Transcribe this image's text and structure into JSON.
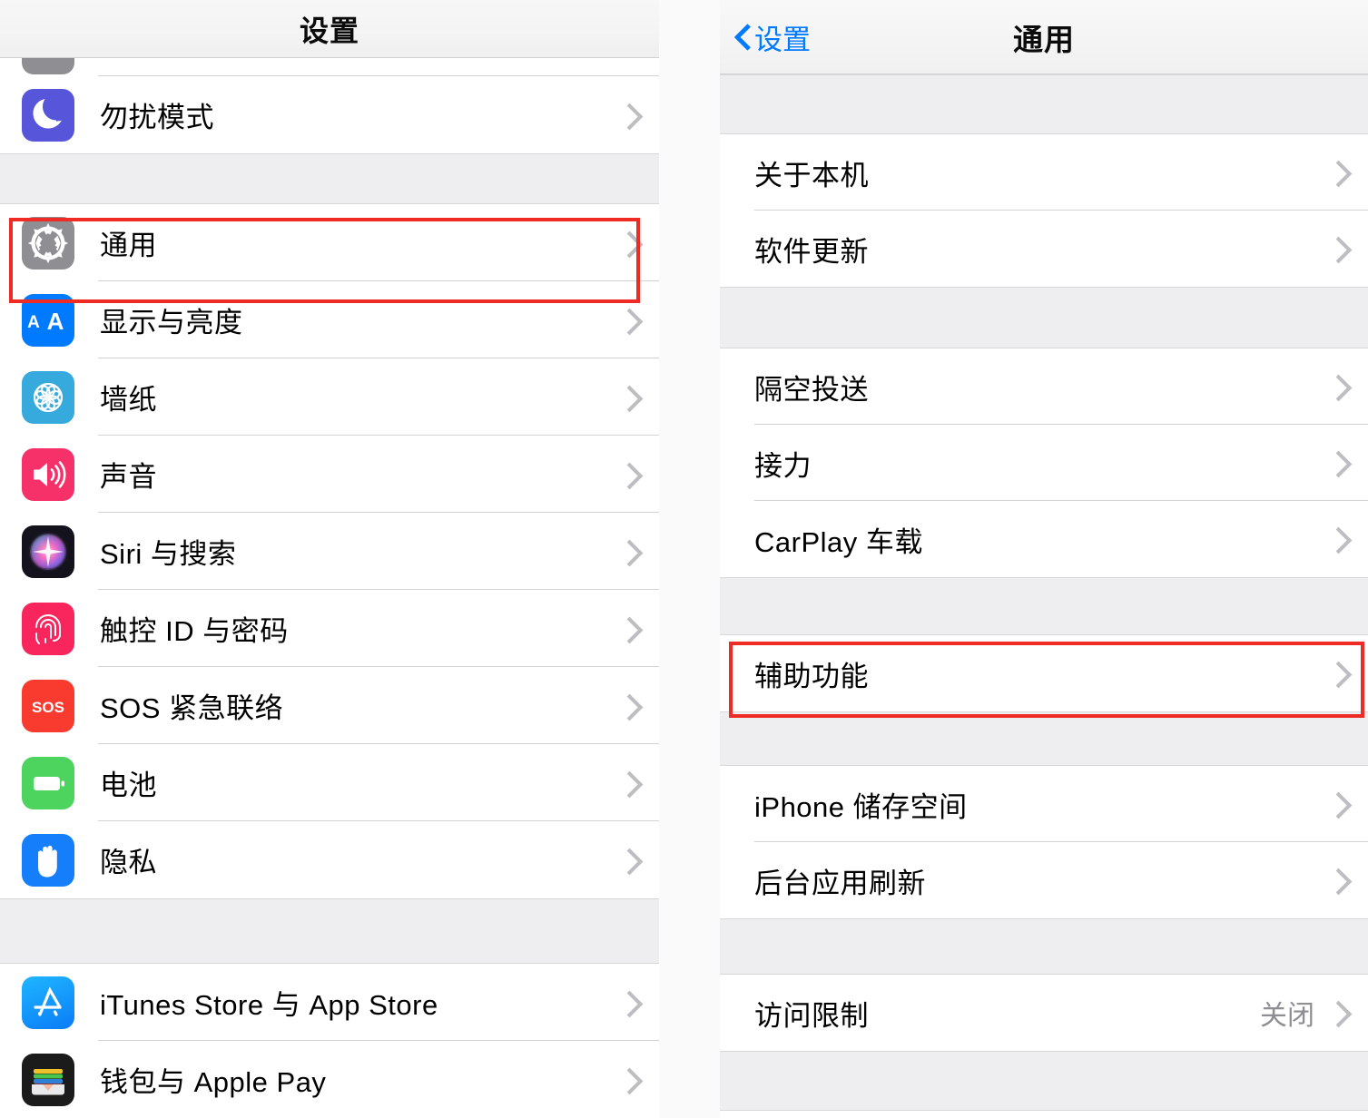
{
  "left_panel": {
    "nav": {
      "title": "设置"
    },
    "partial_row_above": {
      "icon": "notifications-icon-partial"
    },
    "sections": [
      {
        "rows": [
          {
            "label": "勿扰模式",
            "icon": "moon-icon",
            "icon_class": "ic-dnd",
            "accessory": "chevron"
          }
        ]
      },
      {
        "rows": [
          {
            "label": "通用",
            "icon": "gear-icon",
            "icon_class": "ic-general",
            "accessory": "chevron",
            "highlighted": true
          },
          {
            "label": "显示与亮度",
            "icon": "aa-text-icon",
            "icon_class": "ic-display",
            "accessory": "chevron"
          },
          {
            "label": "墙纸",
            "icon": "flower-icon",
            "icon_class": "ic-wall",
            "accessory": "chevron"
          },
          {
            "label": "声音",
            "icon": "speaker-icon",
            "icon_class": "ic-sound",
            "accessory": "chevron"
          },
          {
            "label": "Siri 与搜索",
            "icon": "siri-icon",
            "icon_class": "ic-siri",
            "accessory": "chevron"
          },
          {
            "label": "触控 ID 与密码",
            "icon": "fingerprint-icon",
            "icon_class": "ic-touchid",
            "accessory": "chevron"
          },
          {
            "label": "SOS 紧急联络",
            "icon": "sos-icon",
            "icon_class": "ic-sos",
            "accessory": "chevron"
          },
          {
            "label": "电池",
            "icon": "battery-icon",
            "icon_class": "ic-battery",
            "accessory": "chevron"
          },
          {
            "label": "隐私",
            "icon": "hand-icon",
            "icon_class": "ic-privacy",
            "accessory": "chevron"
          }
        ]
      },
      {
        "rows": [
          {
            "label": "iTunes Store 与 App Store",
            "icon": "app-store-icon",
            "icon_class": "ic-itunes",
            "accessory": "chevron"
          },
          {
            "label": "钱包与 Apple Pay",
            "icon": "wallet-icon",
            "icon_class": "ic-wallet",
            "accessory": "chevron"
          }
        ]
      }
    ]
  },
  "right_panel": {
    "nav": {
      "back_label": "设置",
      "title": "通用",
      "back_icon": "chevron-left-icon"
    },
    "sections": [
      {
        "rows": [
          {
            "label": "关于本机",
            "accessory": "chevron"
          },
          {
            "label": "软件更新",
            "accessory": "chevron"
          }
        ]
      },
      {
        "rows": [
          {
            "label": "隔空投送",
            "accessory": "chevron"
          },
          {
            "label": "接力",
            "accessory": "chevron"
          },
          {
            "label": "CarPlay 车载",
            "accessory": "chevron"
          }
        ]
      },
      {
        "rows": [
          {
            "label": "辅助功能",
            "accessory": "chevron",
            "highlighted": true
          }
        ]
      },
      {
        "rows": [
          {
            "label": "iPhone 储存空间",
            "accessory": "chevron"
          },
          {
            "label": "后台应用刷新",
            "accessory": "chevron"
          }
        ]
      },
      {
        "rows": [
          {
            "label": "访问限制",
            "value": "关闭",
            "accessory": "chevron"
          }
        ]
      }
    ]
  },
  "annotations": {
    "highlight_color": "#ee2b25",
    "boxes": [
      {
        "name": "general-row-highlight",
        "target": "通用"
      },
      {
        "name": "accessibility-row-highlight",
        "target": "辅助功能"
      }
    ]
  }
}
